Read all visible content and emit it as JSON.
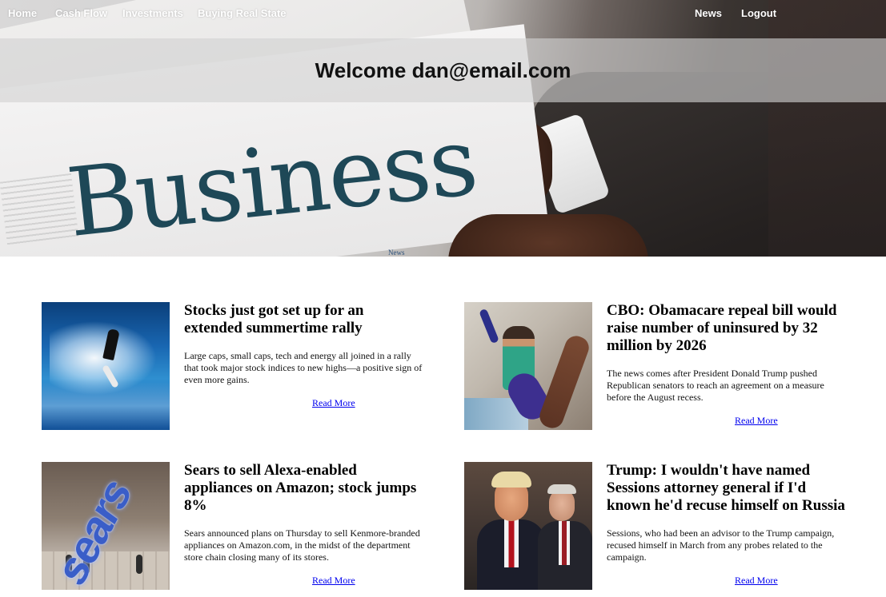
{
  "nav": {
    "home": "Home",
    "cash_flow": "Cash Flow",
    "investments": "Investments",
    "buying_real_state": "Buying Real State",
    "news": "News",
    "logout": "Logout"
  },
  "hero": {
    "welcome": "Welcome dan@email.com",
    "masthead": "Business",
    "paper_label": "News"
  },
  "articles": [
    {
      "headline": "Stocks just got set up for an extended summertime rally",
      "summary": "Large caps, small caps, tech and energy all joined in a rally that took major stock indices to new highs—a positive sign of even more gains.",
      "read_more": "Read More",
      "image": "surfer-wave-image"
    },
    {
      "headline": "CBO: Obamacare repeal bill would raise number of uninsured by 32 million by 2026",
      "summary": "The news comes after President Donald Trump pushed Republican senators to reach an agreement on a measure before the August recess.",
      "read_more": "Read More",
      "image": "hospital-patient-image"
    },
    {
      "headline": "Sears to sell Alexa-enabled appliances on Amazon; stock jumps 8%",
      "summary": "Sears announced plans on Thursday to sell Kenmore-branded appliances on Amazon.com, in the midst of the department store chain closing many of its stores.",
      "read_more": "Read More",
      "image": "sears-store-image",
      "image_text": "sears"
    },
    {
      "headline": "Trump: I wouldn't have named Sessions attorney general if I'd known he'd recuse himself on Russia",
      "summary": "Sessions, who had been an advisor to the Trump campaign, recused himself in March from any probes related to the campaign.",
      "read_more": "Read More",
      "image": "trump-sessions-image"
    }
  ],
  "colors": {
    "link": "#0000ee",
    "nav_text": "#ffffff",
    "welcome_band": "#d2d2d2",
    "masthead": "#1e4857"
  }
}
